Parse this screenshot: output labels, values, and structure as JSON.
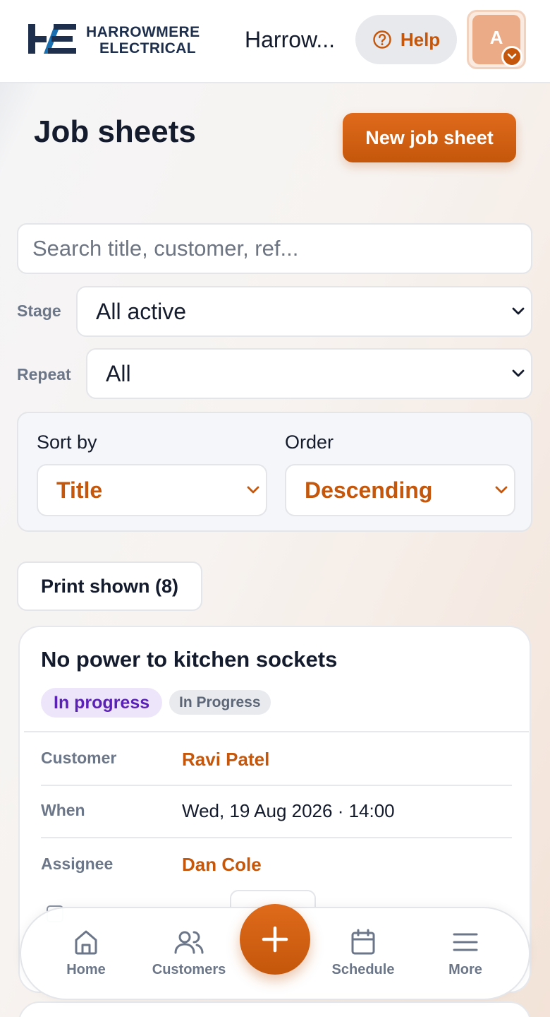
{
  "header": {
    "logo_line1": "HARROWMERE",
    "logo_line2": "ELECTRICAL",
    "org_name": "Harrow...",
    "help_label": "Help",
    "avatar_initial": "A"
  },
  "page": {
    "title": "Job sheets",
    "new_button": "New job sheet"
  },
  "filters": {
    "search_placeholder": "Search title, customer, ref...",
    "stage_label": "Stage",
    "stage_value": "All active",
    "repeat_label": "Repeat",
    "repeat_value": "All",
    "sort_label": "Sort by",
    "sort_value": "Title",
    "order_label": "Order",
    "order_value": "Descending"
  },
  "actions": {
    "print_label": "Print shown (8)"
  },
  "job_card": {
    "title": "No power to kitchen sockets",
    "status_badge": "In progress",
    "stage_badge": "In Progress",
    "rows": [
      {
        "label": "Customer",
        "value": "Ravi Patel"
      },
      {
        "label": "When",
        "value": "Wed, 19 Aug 2026 · 14:00"
      },
      {
        "label": "Assignee",
        "value": "Dan Cole"
      }
    ]
  },
  "bottom_nav": {
    "items": [
      {
        "label": "Home",
        "icon": "home-icon"
      },
      {
        "label": "Customers",
        "icon": "users-icon"
      },
      {
        "label": "Schedule",
        "icon": "calendar-icon"
      },
      {
        "label": "More",
        "icon": "menu-icon"
      }
    ],
    "fab_icon": "plus-icon"
  },
  "colors": {
    "accent": "#c4570b",
    "brand_navy": "#1d2f4c",
    "status_purple": "#5b21b6",
    "muted_label": "#6b7688"
  }
}
